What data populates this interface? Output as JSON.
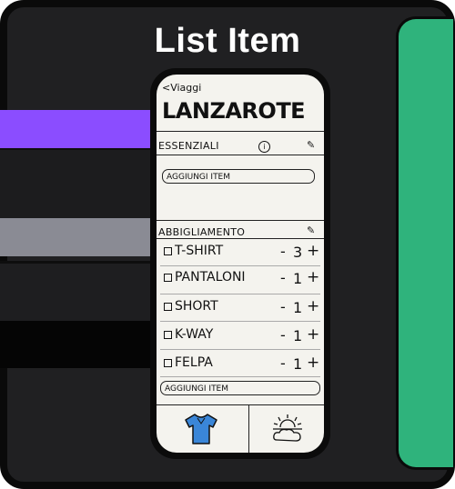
{
  "title": "List Item",
  "phone": {
    "back_label": "<Viaggi",
    "trip_title": "LANZAROTE",
    "sections": [
      {
        "name": "ESSENZIALI",
        "add_label": "AGGIUNGI ITEM"
      },
      {
        "name": "ABBIGLIAMENTO",
        "add_label": "AGGIUNGI ITEM"
      }
    ],
    "items": [
      {
        "name": "T-SHIRT",
        "qty": "3"
      },
      {
        "name": "PANTALONI",
        "qty": "1"
      },
      {
        "name": "SHORT",
        "qty": "1"
      },
      {
        "name": "K-WAY",
        "qty": "1"
      },
      {
        "name": "FELPA",
        "qty": "1"
      }
    ],
    "minus_glyph": "-",
    "plus_glyph": "+",
    "info_glyph": "i",
    "pencil_glyph": "✎",
    "tabs": [
      {
        "icon": "tshirt-icon",
        "color": "#3a86d8"
      },
      {
        "icon": "sun-cloud-icon"
      }
    ]
  },
  "colors": {
    "background": "#202022",
    "purple": "#8b4dff",
    "gray": "#8a8b94",
    "green": "#2fb37c"
  }
}
